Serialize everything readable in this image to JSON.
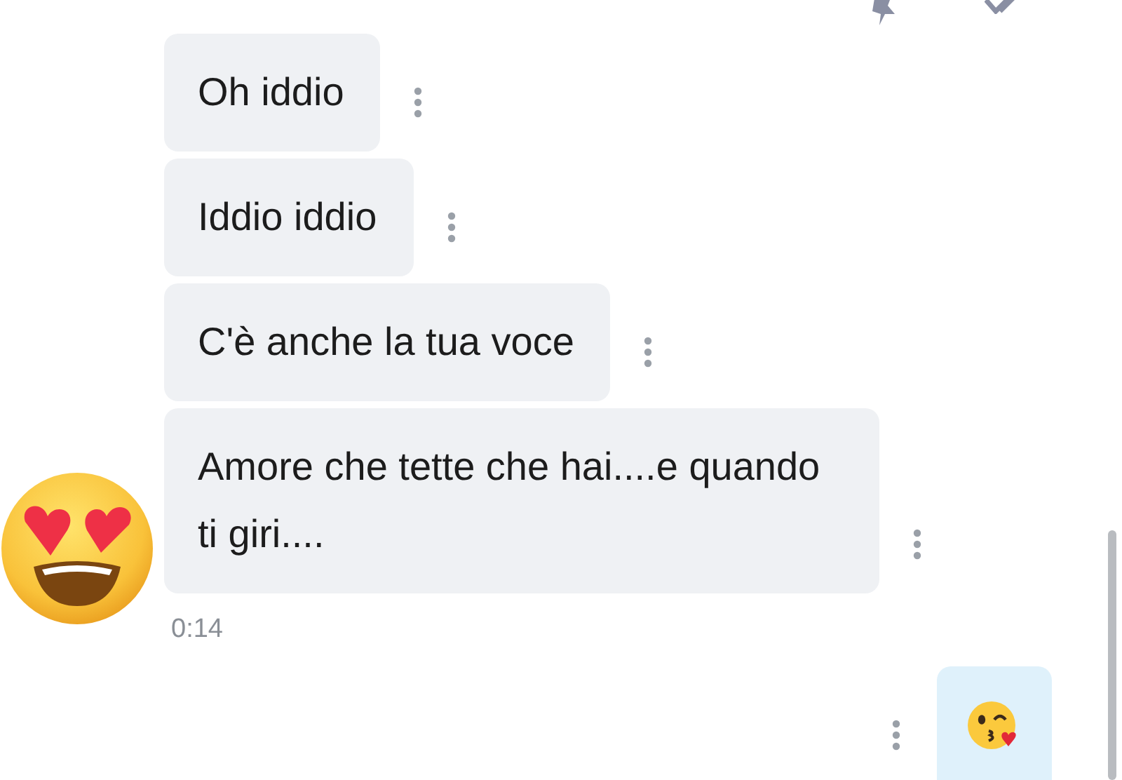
{
  "messages": [
    {
      "kind": "incoming",
      "text": "Oh iddio"
    },
    {
      "kind": "incoming",
      "text": "Iddio iddio"
    },
    {
      "kind": "incoming",
      "text": "C'è anche la tua voce"
    },
    {
      "kind": "incoming",
      "text": "Amore che tette che hai....e quando ti giri...."
    }
  ],
  "incoming_time": "0:14",
  "outgoing": {
    "kind": "kiss-emoji"
  }
}
